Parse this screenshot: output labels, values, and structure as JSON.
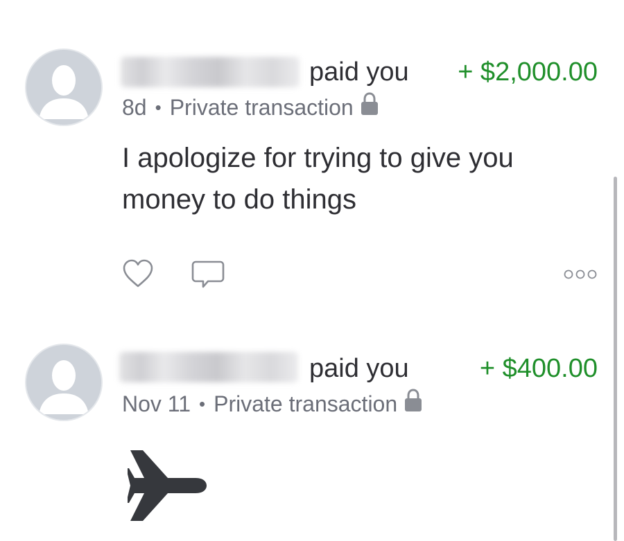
{
  "feed": {
    "items": [
      {
        "sender_name": "",
        "action_text": "paid you",
        "amount": "+ $2,000.00",
        "time": "8d",
        "separator": "•",
        "privacy": "Private transaction",
        "note": "I apologize for trying to give you money to do things",
        "icons": {
          "avatar": "default-user-avatar",
          "privacy": "lock-icon",
          "like": "heart-icon",
          "comment": "comment-icon",
          "more": "more-options-icon"
        }
      },
      {
        "sender_name": "",
        "action_text": "paid you",
        "amount": "+ $400.00",
        "time": "Nov 11",
        "separator": "•",
        "privacy": "Private transaction",
        "note_emoji": "airplane-icon",
        "icons": {
          "avatar": "default-user-avatar",
          "privacy": "lock-icon"
        }
      }
    ]
  },
  "colors": {
    "amount_green": "#1f8f2a",
    "text_dark": "#2e2e33",
    "text_gray": "#6b6e78",
    "icon_gray": "#8a8d94"
  }
}
